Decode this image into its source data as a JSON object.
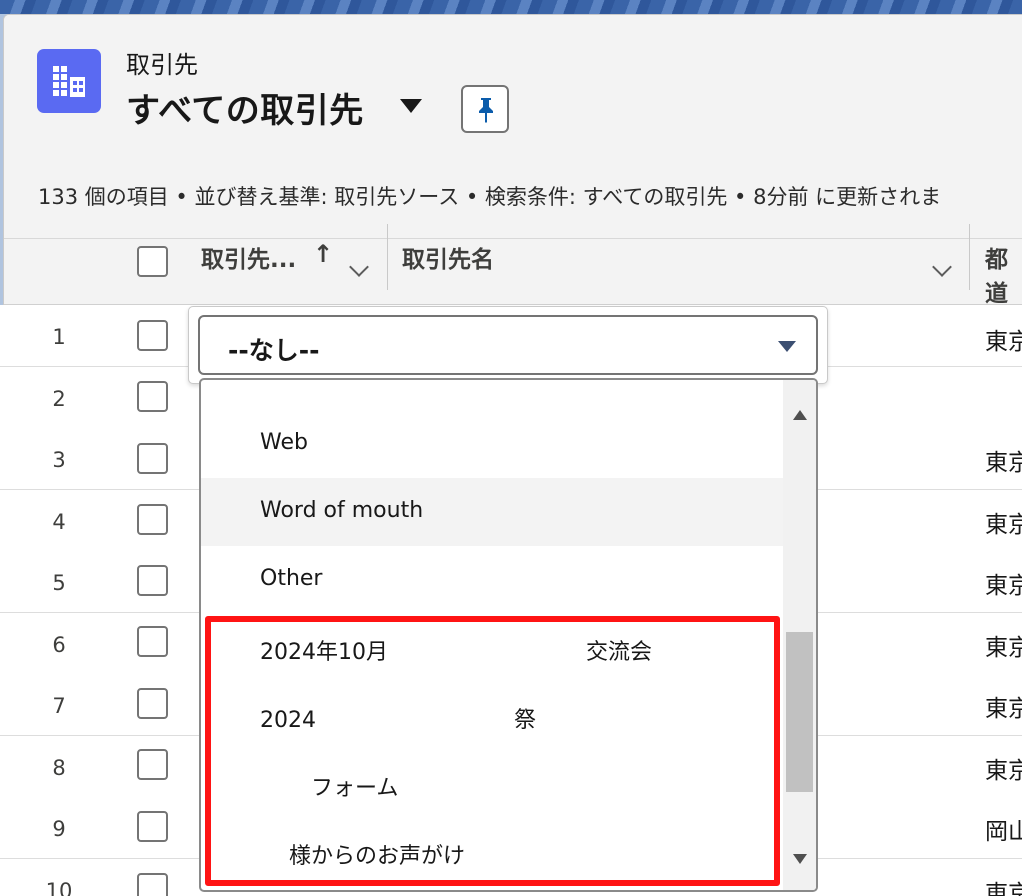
{
  "header": {
    "object_label": "取引先",
    "view_title": "すべての取引先",
    "meta_line": "133 個の項目 • 並び替え基準: 取引先ソース • 検索条件: すべての取引先 • 8分前 に更新されま"
  },
  "table": {
    "columns": {
      "source": "取引先...",
      "sort_arrow": "↑",
      "name": "取引先名",
      "prefecture": "都道"
    },
    "rows": [
      {
        "num": "1",
        "pref": "東京"
      },
      {
        "num": "2",
        "pref": ""
      },
      {
        "num": "3",
        "pref": "東京"
      },
      {
        "num": "4",
        "pref": "東京"
      },
      {
        "num": "5",
        "pref": "東京"
      },
      {
        "num": "6",
        "pref": "東京"
      },
      {
        "num": "7",
        "pref": "東京"
      },
      {
        "num": "8",
        "pref": "東京"
      },
      {
        "num": "9",
        "pref": "岡山"
      },
      {
        "num": "10",
        "pref": "東京"
      }
    ]
  },
  "editor": {
    "combobox_value": "--なし--",
    "options": [
      "Web",
      "Word of mouth",
      "Other",
      "2024年10月　　　　　　　　　交流会",
      "2024　　　　　　　　　祭",
      "フォーム",
      "様からのお声がけ"
    ]
  },
  "colors": {
    "icon_bg": "#5a6af2",
    "highlight": "#ff1414"
  }
}
